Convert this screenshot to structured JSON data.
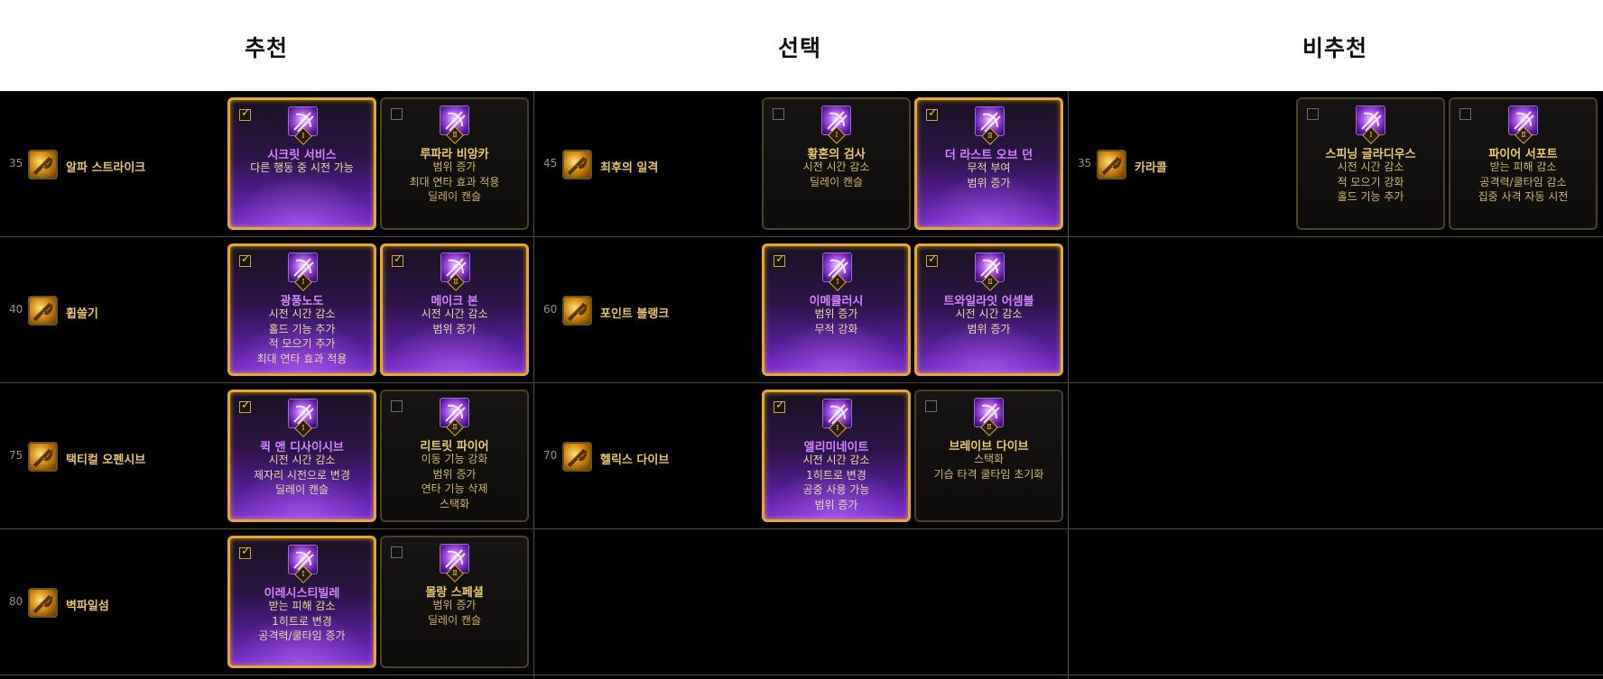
{
  "headers": {
    "recommended": "추천",
    "optional": "선택",
    "not_recommended": "비추천"
  },
  "colors": {
    "selected_border": "#e5a82c",
    "selected_name": "#d583ff",
    "gold_text": "#e7c46d",
    "background": "#000000"
  },
  "icons": {
    "checked": "✓",
    "tier1": "Ⅰ",
    "tier2": "Ⅱ"
  },
  "rows": [
    {
      "cells": [
        {
          "level": "35",
          "skill": "알파 스트라이크",
          "skill_icon": "dagger-strike-icon",
          "tripods": [
            {
              "name": "시크릿 서비스",
              "desc": [
                "다른 행동 중 시전 가능"
              ],
              "selected": true,
              "tier": "Ⅰ"
            },
            {
              "name": "루파라 비앙카",
              "desc": [
                "범위 증가",
                "최대 연타 효과 적용",
                "딜레이 캔슬"
              ],
              "selected": false,
              "tier": "Ⅱ"
            }
          ]
        },
        {
          "level": "45",
          "skill": "최후의 일격",
          "skill_icon": "crescent-slash-icon",
          "tripods": [
            {
              "name": "황혼의 검사",
              "desc": [
                "시전 시간 감소",
                "딜레이 캔슬"
              ],
              "selected": false,
              "tier": "Ⅰ"
            },
            {
              "name": "더 라스트 오브 던",
              "desc": [
                "무적 부여",
                "범위 증가"
              ],
              "selected": true,
              "tier": "Ⅱ"
            }
          ]
        },
        {
          "level": "35",
          "skill": "카라콜",
          "skill_icon": "spin-dash-icon",
          "tripods": [
            {
              "name": "스피닝 글라디우스",
              "desc": [
                "시전 시간 감소",
                "적 모으기 강화",
                "홀드 기능 추가"
              ],
              "selected": false,
              "tier": "Ⅰ"
            },
            {
              "name": "파이어 서포트",
              "desc": [
                "받는 피해 감소",
                "공격력/쿨타임 감소",
                "집중 사격 자동 시전"
              ],
              "selected": false,
              "tier": "Ⅱ"
            }
          ]
        }
      ]
    },
    {
      "cells": [
        {
          "level": "40",
          "skill": "휩쓸기",
          "skill_icon": "sweep-icon",
          "tripods": [
            {
              "name": "광풍노도",
              "desc": [
                "시전 시간 감소",
                "홀드 기능 추가",
                "적 모으기 추가",
                "최대 연타 효과 적용"
              ],
              "selected": true,
              "tier": "Ⅰ"
            },
            {
              "name": "메이크 본",
              "desc": [
                "시전 시간 감소",
                "범위 증가"
              ],
              "selected": true,
              "tier": "Ⅱ"
            }
          ]
        },
        {
          "level": "60",
          "skill": "포인트 블랭크",
          "skill_icon": "point-blank-icon",
          "tripods": [
            {
              "name": "이메큘러시",
              "desc": [
                "범위 증가",
                "무적 강화"
              ],
              "selected": true,
              "tier": "Ⅰ"
            },
            {
              "name": "트와일라잇 어셈블",
              "desc": [
                "시전 시간 감소",
                "범위 증가"
              ],
              "selected": true,
              "tier": "Ⅱ"
            }
          ]
        }
      ]
    },
    {
      "cells": [
        {
          "level": "75",
          "skill": "택티컬 오펜시브",
          "skill_icon": "tactical-blade-icon",
          "tripods": [
            {
              "name": "퀵 앤 디사이시브",
              "desc": [
                "시전 시간 감소",
                "제자리 시전으로 변경",
                "딜레이 캔슬"
              ],
              "selected": true,
              "tier": "Ⅰ"
            },
            {
              "name": "리트릿 파이어",
              "desc": [
                "이동 기능 강화",
                "범위 증가",
                "연타 기능 삭제",
                "스택화"
              ],
              "selected": false,
              "tier": "Ⅱ"
            }
          ]
        },
        {
          "level": "70",
          "skill": "헬릭스 다이브",
          "skill_icon": "helix-dive-icon",
          "tripods": [
            {
              "name": "엘리미네이트",
              "desc": [
                "시전 시간 감소",
                "1히트로 변경",
                "공중 사용 가능",
                "범위 증가"
              ],
              "selected": true,
              "tier": "Ⅰ"
            },
            {
              "name": "브레이브 다이브",
              "desc": [
                "스택화",
                "기습 타격 쿨타임 초기화"
              ],
              "selected": false,
              "tier": "Ⅱ"
            }
          ]
        }
      ]
    },
    {
      "cells": [
        {
          "level": "80",
          "skill": "벽파일섬",
          "skill_icon": "cross-slash-icon",
          "tripods": [
            {
              "name": "이레시스티빌레",
              "desc": [
                "받는 피해 감소",
                "1히트로 변경",
                "공격력/쿨타임 증가"
              ],
              "selected": true,
              "tier": "Ⅰ"
            },
            {
              "name": "몰랑 스페셜",
              "desc": [
                "범위 증가",
                "딜레이 캔슬"
              ],
              "selected": false,
              "tier": "Ⅱ"
            }
          ]
        }
      ]
    }
  ]
}
